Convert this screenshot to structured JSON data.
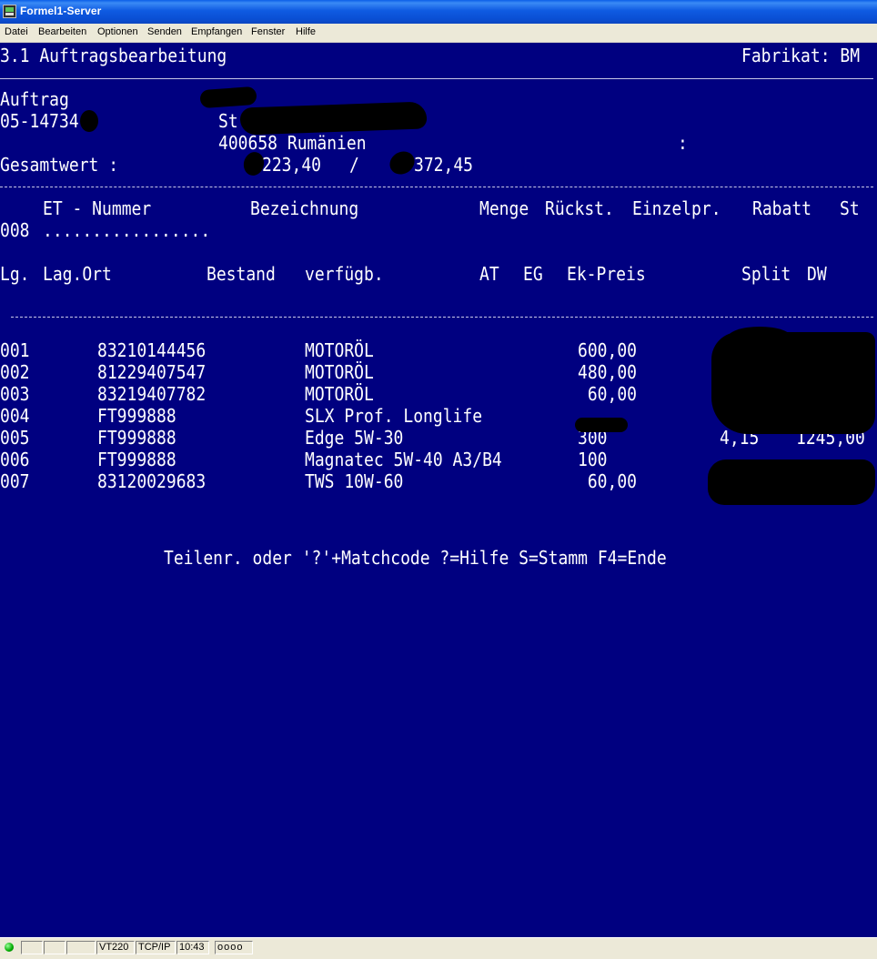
{
  "window": {
    "title": "Formel1-Server"
  },
  "menu": [
    "Datei",
    "Bearbeiten",
    "Optionen",
    "Senden",
    "Empfangen",
    "Fenster",
    "Hilfe"
  ],
  "screen": {
    "heading": "3.1 Auftragsbearbeitung",
    "brand_label": "Fabrikat: BM",
    "order_label": "Auftrag",
    "order_number": "05-14734",
    "customer_prefix": "St",
    "customer_line": "400658 Rumänien",
    "colon_marker": ":",
    "total_label": "Gesamtwert :",
    "total_value_1": "223,40",
    "total_sep": "/",
    "total_value_2": "372,45",
    "header1": {
      "et_nummer": "ET - Nummer",
      "bezeichnung": "Bezeichnung",
      "menge": "Menge",
      "rueckst": "Rückst.",
      "einzelpr": "Einzelpr.",
      "rabatt": "Rabatt",
      "st": "St"
    },
    "entry_line": {
      "pos": "008",
      "field": "................."
    },
    "header2": {
      "lg": "Lg.",
      "lag_ort": "Lag.Ort",
      "bestand": "Bestand",
      "verfuegb": "verfügb.",
      "at": "AT",
      "eg": "EG",
      "ek_preis": "Ek-Preis",
      "split": "Split",
      "dw": "DW"
    },
    "rows": [
      {
        "pos": "001",
        "part": "83210144456",
        "desc": "MOTORÖL",
        "qty": "600,00",
        "c1": "",
        "c2": ""
      },
      {
        "pos": "002",
        "part": "81229407547",
        "desc": "MOTORÖL",
        "qty": "480,00",
        "c1": "",
        "c2": ""
      },
      {
        "pos": "003",
        "part": "83219407782",
        "desc": "MOTORÖL",
        "qty": " 60,00",
        "c1": "",
        "c2": ""
      },
      {
        "pos": "004",
        "part": "FT999888",
        "desc": "SLX Prof. Longlife",
        "qty": "",
        "c1": "",
        "c2": ""
      },
      {
        "pos": "005",
        "part": "FT999888",
        "desc": "Edge 5W-30",
        "qty": "300",
        "c1": "4,15",
        "c2": "1245,00"
      },
      {
        "pos": "006",
        "part": "FT999888",
        "desc": "Magnatec 5W-40 A3/B4",
        "qty": "100",
        "c1": "",
        "c2": ""
      },
      {
        "pos": "007",
        "part": "83120029683",
        "desc": "TWS 10W-60",
        "qty": " 60,00",
        "c1": "",
        "c2": ""
      }
    ],
    "prompt": "Teilenr. oder '?'+Matchcode ?=Hilfe S=Stamm F4=Ende"
  },
  "statusbar": {
    "terminal_type": "VT220",
    "protocol": "TCP/IP",
    "time": "10:43",
    "indicators": "oooo"
  },
  "colors": {
    "terminal_bg": "#000080",
    "terminal_fg": "#ffffff",
    "status_led": "#00aa00"
  }
}
